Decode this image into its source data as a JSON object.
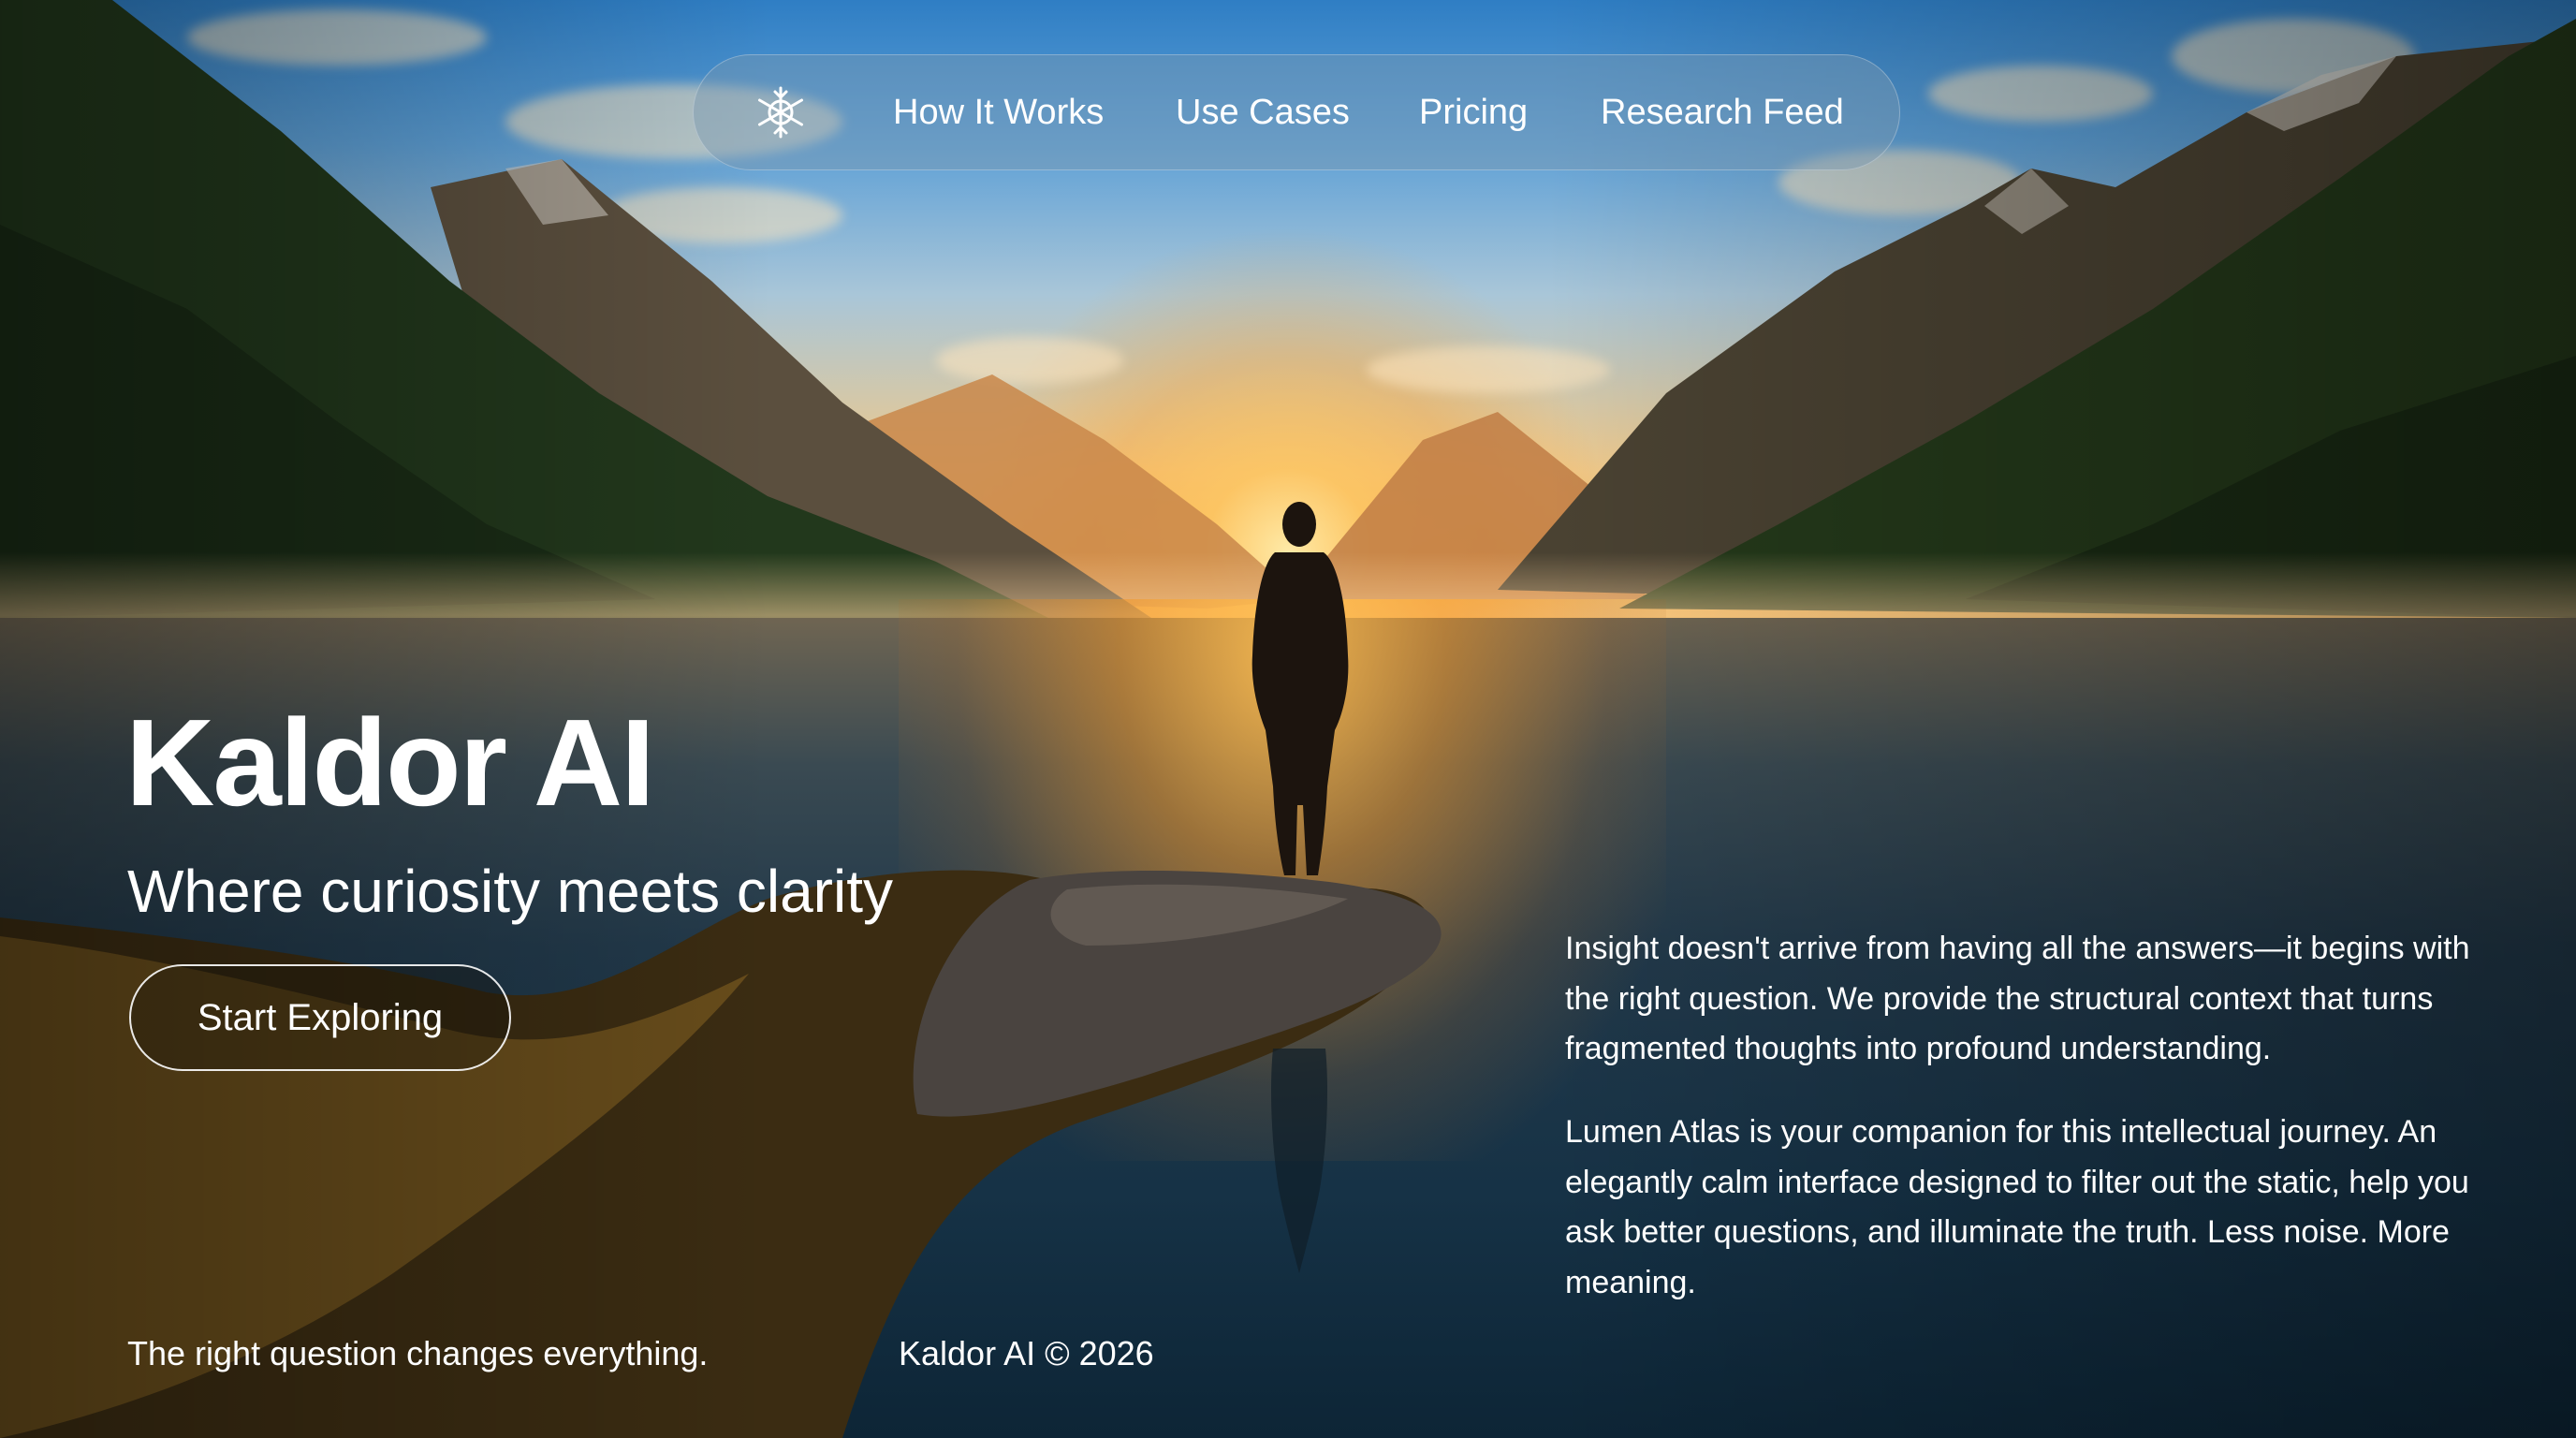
{
  "nav": {
    "logo_icon": "snowflake-wheel-icon",
    "links": [
      "How It Works",
      "Use Cases",
      "Pricing",
      "Research Feed"
    ]
  },
  "hero": {
    "title": "Kaldor AI",
    "subtitle": "Where curiosity meets clarity",
    "cta_label": "Start Exploring"
  },
  "description": {
    "paragraph_1": "Insight doesn't arrive from having all the answers—it begins with the right question. We provide the structural context that turns fragmented thoughts into profound understanding.",
    "paragraph_2": "Lumen Atlas is your companion for this intellectual journey. An elegantly calm interface designed to filter out the static, help you ask better questions, and illuminate the truth. Less noise. More meaning."
  },
  "footer": {
    "tagline": "The right question changes everything.",
    "copyright": "Kaldor AI © 2026"
  },
  "colors": {
    "text": "#ffffff",
    "sky_top": "#2f7ec4",
    "sun": "#ffb748",
    "water": "#163246"
  }
}
